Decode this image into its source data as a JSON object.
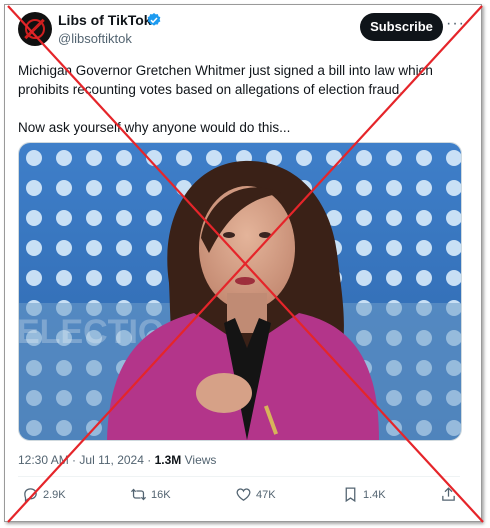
{
  "account": {
    "name": "Libs of TikTok",
    "handle": "@libsoftiktok",
    "verified": true,
    "subscribe_label": "Subscribe",
    "more_label": "···"
  },
  "tweet": {
    "text_line1": "Michigan Governor Gretchen Whitmer just signed a bill into law which prohibits recounting votes based on allegations of election fraud.",
    "text_line2": "Now ask yourself why anyone would do this...",
    "time": "12:30 AM",
    "date": "Jul 11, 2024",
    "separator": "·",
    "views_count": "1.3M",
    "views_label": "Views",
    "photo_backdrop_text": "ELECTIO"
  },
  "actions": {
    "replies": "2.9K",
    "reposts": "16K",
    "likes": "47K",
    "bookmarks": "1.4K"
  },
  "colors": {
    "accent": "#1d9bf0",
    "subscribe_bg": "#0f1419",
    "cross_line": "#e5252a",
    "secondary_text": "#536471"
  }
}
